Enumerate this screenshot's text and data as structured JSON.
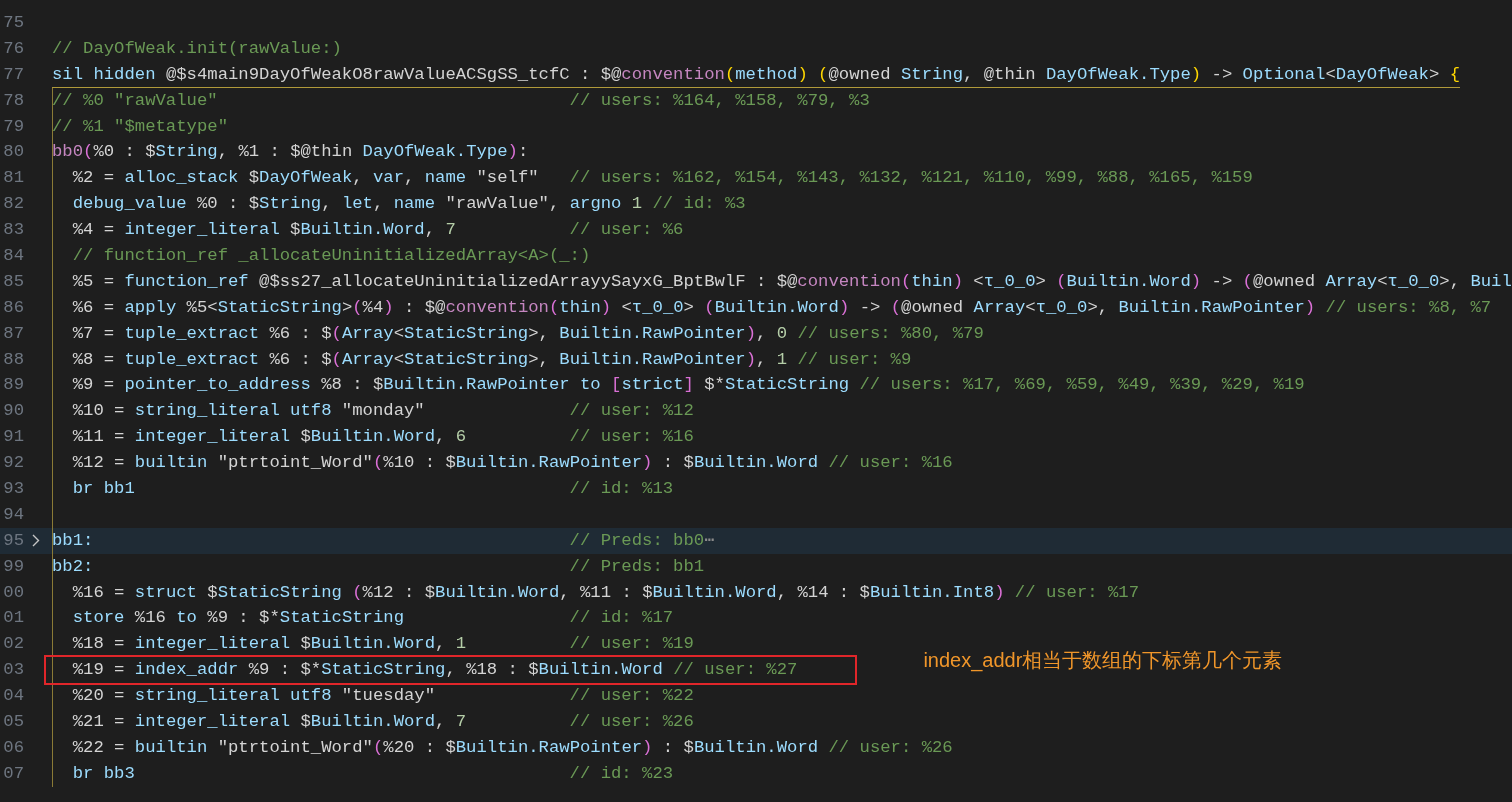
{
  "editor": {
    "lines": [
      {
        "number": "75"
      },
      {
        "number": "76",
        "code": [
          {
            "text": "// DayOfWeak.init(rawValue:)",
            "kind": "comment"
          }
        ]
      },
      {
        "number": "77",
        "code": [
          {
            "text": "sil hidden",
            "kind": "ident"
          },
          {
            "text": " @$s4main9DayOfWeakO8rawValueACSgSS_tcfC : $@",
            "kind": "plain"
          },
          {
            "text": "convention",
            "kind": "keyword"
          },
          {
            "text": "(",
            "kind": "bracket1"
          },
          {
            "text": "method",
            "kind": "ident"
          },
          {
            "text": ")",
            "kind": "bracket1"
          },
          {
            "text": " (",
            "kind": "bracket1"
          },
          {
            "text": "@owned ",
            "kind": "plain"
          },
          {
            "text": "String",
            "kind": "ident"
          },
          {
            "text": ", @thin ",
            "kind": "plain"
          },
          {
            "text": "DayOfWeak.Type",
            "kind": "ident"
          },
          {
            "text": ")",
            "kind": "bracket1"
          },
          {
            "text": " -> ",
            "kind": "plain"
          },
          {
            "text": "Optional",
            "kind": "ident"
          },
          {
            "text": "<",
            "kind": "plain"
          },
          {
            "text": "DayOfWeak",
            "kind": "ident"
          },
          {
            "text": "> ",
            "kind": "plain"
          },
          {
            "text": "{",
            "kind": "bracket1"
          }
        ],
        "bracket_open": true
      },
      {
        "number": "78",
        "code": [
          {
            "text": "// %0 \"rawValue\"",
            "kind": "comment"
          }
        ],
        "comment": "// users: %164, %158, %79, %3",
        "guide": true
      },
      {
        "number": "79",
        "code": [
          {
            "text": "// %1 \"$metatype\"",
            "kind": "comment"
          }
        ],
        "guide": true
      },
      {
        "number": "80",
        "code": [
          {
            "text": "bb0",
            "kind": "keyword"
          },
          {
            "text": "(",
            "kind": "bracket2"
          },
          {
            "text": "%0 : $",
            "kind": "plain"
          },
          {
            "text": "String",
            "kind": "ident"
          },
          {
            "text": ", %1 : $@thin ",
            "kind": "plain"
          },
          {
            "text": "DayOfWeak.Type",
            "kind": "ident"
          },
          {
            "text": ")",
            "kind": "bracket2"
          },
          {
            "text": ":",
            "kind": "plain"
          }
        ],
        "guide": true
      },
      {
        "number": "81",
        "code": [
          {
            "text": "  %2 = ",
            "kind": "plain"
          },
          {
            "text": "alloc_stack",
            "kind": "ident"
          },
          {
            "text": " $",
            "kind": "plain"
          },
          {
            "text": "DayOfWeak",
            "kind": "ident"
          },
          {
            "text": ", ",
            "kind": "plain"
          },
          {
            "text": "var",
            "kind": "ident"
          },
          {
            "text": ", ",
            "kind": "plain"
          },
          {
            "text": "name",
            "kind": "ident"
          },
          {
            "text": " \"self\" ",
            "kind": "plain"
          }
        ],
        "comment": "// users: %162, %154, %143, %132, %121, %110, %99, %88, %165, %159",
        "guide": true
      },
      {
        "number": "82",
        "code": [
          {
            "text": "  debug_value",
            "kind": "ident"
          },
          {
            "text": " %0 : $",
            "kind": "plain"
          },
          {
            "text": "String",
            "kind": "ident"
          },
          {
            "text": ", ",
            "kind": "plain"
          },
          {
            "text": "let",
            "kind": "ident"
          },
          {
            "text": ", ",
            "kind": "plain"
          },
          {
            "text": "name",
            "kind": "ident"
          },
          {
            "text": " \"rawValue\", ",
            "kind": "plain"
          },
          {
            "text": "argno",
            "kind": "ident"
          },
          {
            "text": " 1 ",
            "kind": "number"
          }
        ],
        "comment": "// id: %3",
        "guide": true
      },
      {
        "number": "83",
        "code": [
          {
            "text": "  %4 = ",
            "kind": "plain"
          },
          {
            "text": "integer_literal",
            "kind": "ident"
          },
          {
            "text": " $",
            "kind": "plain"
          },
          {
            "text": "Builtin.Word",
            "kind": "ident"
          },
          {
            "text": ", ",
            "kind": "plain"
          },
          {
            "text": "7",
            "kind": "number"
          }
        ],
        "comment": "// user: %6",
        "guide": true
      },
      {
        "number": "84",
        "code": [
          {
            "text": "  // function_ref _allocateUninitializedArray<A>(_:)",
            "kind": "comment"
          }
        ],
        "guide": true
      },
      {
        "number": "85",
        "code": [
          {
            "text": "  %5 = ",
            "kind": "plain"
          },
          {
            "text": "function_ref",
            "kind": "ident"
          },
          {
            "text": " @$ss27_allocateUninitializedArrayySayxG_BptBwlF : $@",
            "kind": "plain"
          },
          {
            "text": "convention",
            "kind": "keyword"
          },
          {
            "text": "(",
            "kind": "bracket2"
          },
          {
            "text": "thin",
            "kind": "ident"
          },
          {
            "text": ")",
            "kind": "bracket2"
          },
          {
            "text": " <",
            "kind": "plain"
          },
          {
            "text": "τ_0_0",
            "kind": "ident"
          },
          {
            "text": "> ",
            "kind": "plain"
          },
          {
            "text": "(",
            "kind": "bracket2"
          },
          {
            "text": "Builtin.Word",
            "kind": "ident"
          },
          {
            "text": ")",
            "kind": "bracket2"
          },
          {
            "text": " -> ",
            "kind": "plain"
          },
          {
            "text": "(",
            "kind": "bracket2"
          },
          {
            "text": "@owned ",
            "kind": "plain"
          },
          {
            "text": "Array",
            "kind": "ident"
          },
          {
            "text": "<",
            "kind": "plain"
          },
          {
            "text": "τ_0_0",
            "kind": "ident"
          },
          {
            "text": ">, ",
            "kind": "plain"
          },
          {
            "text": "Buil",
            "kind": "ident"
          }
        ],
        "guide": true
      },
      {
        "number": "86",
        "code": [
          {
            "text": "  %6 = ",
            "kind": "plain"
          },
          {
            "text": "apply",
            "kind": "ident"
          },
          {
            "text": " %5<",
            "kind": "plain"
          },
          {
            "text": "StaticString",
            "kind": "ident"
          },
          {
            "text": ">",
            "kind": "plain"
          },
          {
            "text": "(",
            "kind": "bracket2"
          },
          {
            "text": "%4",
            "kind": "plain"
          },
          {
            "text": ")",
            "kind": "bracket2"
          },
          {
            "text": " : $@",
            "kind": "plain"
          },
          {
            "text": "convention",
            "kind": "keyword"
          },
          {
            "text": "(",
            "kind": "bracket2"
          },
          {
            "text": "thin",
            "kind": "ident"
          },
          {
            "text": ")",
            "kind": "bracket2"
          },
          {
            "text": " <",
            "kind": "plain"
          },
          {
            "text": "τ_0_0",
            "kind": "ident"
          },
          {
            "text": "> ",
            "kind": "plain"
          },
          {
            "text": "(",
            "kind": "bracket2"
          },
          {
            "text": "Builtin.Word",
            "kind": "ident"
          },
          {
            "text": ")",
            "kind": "bracket2"
          },
          {
            "text": " -> ",
            "kind": "plain"
          },
          {
            "text": "(",
            "kind": "bracket2"
          },
          {
            "text": "@owned ",
            "kind": "plain"
          },
          {
            "text": "Array",
            "kind": "ident"
          },
          {
            "text": "<",
            "kind": "plain"
          },
          {
            "text": "τ_0_0",
            "kind": "ident"
          },
          {
            "text": ">, ",
            "kind": "plain"
          },
          {
            "text": "Builtin.RawPointer",
            "kind": "ident"
          },
          {
            "text": ") ",
            "kind": "bracket2"
          }
        ],
        "comment": "// users: %8, %7",
        "guide": true
      },
      {
        "number": "87",
        "code": [
          {
            "text": "  %7 = ",
            "kind": "plain"
          },
          {
            "text": "tuple_extract",
            "kind": "ident"
          },
          {
            "text": " %6 : $",
            "kind": "plain"
          },
          {
            "text": "(",
            "kind": "bracket2"
          },
          {
            "text": "Array",
            "kind": "ident"
          },
          {
            "text": "<",
            "kind": "plain"
          },
          {
            "text": "StaticString",
            "kind": "ident"
          },
          {
            "text": ">, ",
            "kind": "plain"
          },
          {
            "text": "Builtin.RawPointer",
            "kind": "ident"
          },
          {
            "text": ")",
            "kind": "bracket2"
          },
          {
            "text": ", ",
            "kind": "plain"
          },
          {
            "text": "0 ",
            "kind": "number"
          }
        ],
        "comment": "// users: %80, %79",
        "guide": true
      },
      {
        "number": "88",
        "code": [
          {
            "text": "  %8 = ",
            "kind": "plain"
          },
          {
            "text": "tuple_extract",
            "kind": "ident"
          },
          {
            "text": " %6 : $",
            "kind": "plain"
          },
          {
            "text": "(",
            "kind": "bracket2"
          },
          {
            "text": "Array",
            "kind": "ident"
          },
          {
            "text": "<",
            "kind": "plain"
          },
          {
            "text": "StaticString",
            "kind": "ident"
          },
          {
            "text": ">, ",
            "kind": "plain"
          },
          {
            "text": "Builtin.RawPointer",
            "kind": "ident"
          },
          {
            "text": ")",
            "kind": "bracket2"
          },
          {
            "text": ", ",
            "kind": "plain"
          },
          {
            "text": "1 ",
            "kind": "number"
          }
        ],
        "comment": "// user: %9",
        "guide": true
      },
      {
        "number": "89",
        "code": [
          {
            "text": "  %9 = ",
            "kind": "plain"
          },
          {
            "text": "pointer_to_address",
            "kind": "ident"
          },
          {
            "text": " %8 : $",
            "kind": "plain"
          },
          {
            "text": "Builtin.RawPointer to",
            "kind": "ident"
          },
          {
            "text": " [",
            "kind": "bracket2"
          },
          {
            "text": "strict",
            "kind": "ident"
          },
          {
            "text": "]",
            "kind": "bracket2"
          },
          {
            "text": " $*",
            "kind": "plain"
          },
          {
            "text": "StaticString ",
            "kind": "ident"
          }
        ],
        "comment": "// users: %17, %69, %59, %49, %39, %29, %19",
        "guide": true
      },
      {
        "number": "90",
        "code": [
          {
            "text": "  %10 = ",
            "kind": "plain"
          },
          {
            "text": "string_literal utf8",
            "kind": "ident"
          },
          {
            "text": " \"monday\"",
            "kind": "plain"
          }
        ],
        "comment": "// user: %12",
        "guide": true
      },
      {
        "number": "91",
        "code": [
          {
            "text": "  %11 = ",
            "kind": "plain"
          },
          {
            "text": "integer_literal",
            "kind": "ident"
          },
          {
            "text": " $",
            "kind": "plain"
          },
          {
            "text": "Builtin.Word",
            "kind": "ident"
          },
          {
            "text": ", ",
            "kind": "plain"
          },
          {
            "text": "6",
            "kind": "number"
          }
        ],
        "comment": "// user: %16",
        "guide": true
      },
      {
        "number": "92",
        "code": [
          {
            "text": "  %12 = ",
            "kind": "plain"
          },
          {
            "text": "builtin",
            "kind": "ident"
          },
          {
            "text": " \"ptrtoint_Word\"",
            "kind": "plain"
          },
          {
            "text": "(",
            "kind": "bracket2"
          },
          {
            "text": "%10 : $",
            "kind": "plain"
          },
          {
            "text": "Builtin.RawPointer",
            "kind": "ident"
          },
          {
            "text": ")",
            "kind": "bracket2"
          },
          {
            "text": " : $",
            "kind": "plain"
          },
          {
            "text": "Builtin.Word ",
            "kind": "ident"
          }
        ],
        "comment": "// user: %16",
        "guide": true
      },
      {
        "number": "93",
        "code": [
          {
            "text": "  br bb1",
            "kind": "ident"
          }
        ],
        "comment": "// id: %13",
        "guide": true
      },
      {
        "number": "94",
        "guide": true
      },
      {
        "number": "95",
        "code": [
          {
            "text": "bb1:",
            "kind": "ident"
          }
        ],
        "comment": "// Preds: bb0",
        "fold_ellipsis": "⋯",
        "guide": true,
        "folded": true,
        "current": true
      },
      {
        "number": "99",
        "code": [
          {
            "text": "bb2:",
            "kind": "ident"
          }
        ],
        "comment": "// Preds: bb1",
        "guide": true
      },
      {
        "number": "00",
        "code": [
          {
            "text": "  %16 = ",
            "kind": "plain"
          },
          {
            "text": "struct",
            "kind": "ident"
          },
          {
            "text": " $",
            "kind": "plain"
          },
          {
            "text": "StaticString ",
            "kind": "ident"
          },
          {
            "text": "(",
            "kind": "bracket2"
          },
          {
            "text": "%12 : $",
            "kind": "plain"
          },
          {
            "text": "Builtin.Word",
            "kind": "ident"
          },
          {
            "text": ", %11 : $",
            "kind": "plain"
          },
          {
            "text": "Builtin.Word",
            "kind": "ident"
          },
          {
            "text": ", %14 : $",
            "kind": "plain"
          },
          {
            "text": "Builtin.Int8",
            "kind": "ident"
          },
          {
            "text": ") ",
            "kind": "bracket2"
          }
        ],
        "comment": "// user: %17",
        "guide": true
      },
      {
        "number": "01",
        "code": [
          {
            "text": "  store",
            "kind": "ident"
          },
          {
            "text": " %16 ",
            "kind": "plain"
          },
          {
            "text": "to",
            "kind": "ident"
          },
          {
            "text": " %9 : $*",
            "kind": "plain"
          },
          {
            "text": "StaticString",
            "kind": "ident"
          }
        ],
        "comment": "// id: %17",
        "guide": true
      },
      {
        "number": "02",
        "code": [
          {
            "text": "  %18 = ",
            "kind": "plain"
          },
          {
            "text": "integer_literal",
            "kind": "ident"
          },
          {
            "text": " $",
            "kind": "plain"
          },
          {
            "text": "Builtin.Word",
            "kind": "ident"
          },
          {
            "text": ", ",
            "kind": "plain"
          },
          {
            "text": "1",
            "kind": "number"
          }
        ],
        "comment": "// user: %19",
        "guide": true
      },
      {
        "number": "03",
        "code": [
          {
            "text": "  %19 = ",
            "kind": "plain"
          },
          {
            "text": "index_addr",
            "kind": "ident"
          },
          {
            "text": " %9 : $*",
            "kind": "plain"
          },
          {
            "text": "StaticString",
            "kind": "ident"
          },
          {
            "text": ", %18 : $",
            "kind": "plain"
          },
          {
            "text": "Builtin.Word ",
            "kind": "ident"
          }
        ],
        "comment": "// user: %27",
        "guide": true,
        "boxed": true
      },
      {
        "number": "04",
        "code": [
          {
            "text": "  %20 = ",
            "kind": "plain"
          },
          {
            "text": "string_literal utf8",
            "kind": "ident"
          },
          {
            "text": " \"tuesday\"",
            "kind": "plain"
          }
        ],
        "comment": "// user: %22",
        "guide": true
      },
      {
        "number": "05",
        "code": [
          {
            "text": "  %21 = ",
            "kind": "plain"
          },
          {
            "text": "integer_literal",
            "kind": "ident"
          },
          {
            "text": " $",
            "kind": "plain"
          },
          {
            "text": "Builtin.Word",
            "kind": "ident"
          },
          {
            "text": ", ",
            "kind": "plain"
          },
          {
            "text": "7",
            "kind": "number"
          }
        ],
        "comment": "// user: %26",
        "guide": true
      },
      {
        "number": "06",
        "code": [
          {
            "text": "  %22 = ",
            "kind": "plain"
          },
          {
            "text": "builtin",
            "kind": "ident"
          },
          {
            "text": " \"ptrtoint_Word\"",
            "kind": "plain"
          },
          {
            "text": "(",
            "kind": "bracket2"
          },
          {
            "text": "%20 : $",
            "kind": "plain"
          },
          {
            "text": "Builtin.RawPointer",
            "kind": "ident"
          },
          {
            "text": ")",
            "kind": "bracket2"
          },
          {
            "text": " : $",
            "kind": "plain"
          },
          {
            "text": "Builtin.Word ",
            "kind": "ident"
          }
        ],
        "comment": "// user: %26",
        "guide": true
      },
      {
        "number": "07",
        "code": [
          {
            "text": "  br bb3",
            "kind": "ident"
          }
        ],
        "comment": "// id: %23",
        "guide": true
      }
    ]
  },
  "annotation": {
    "text": "index_addr相当于数组的下标第几个元素"
  }
}
